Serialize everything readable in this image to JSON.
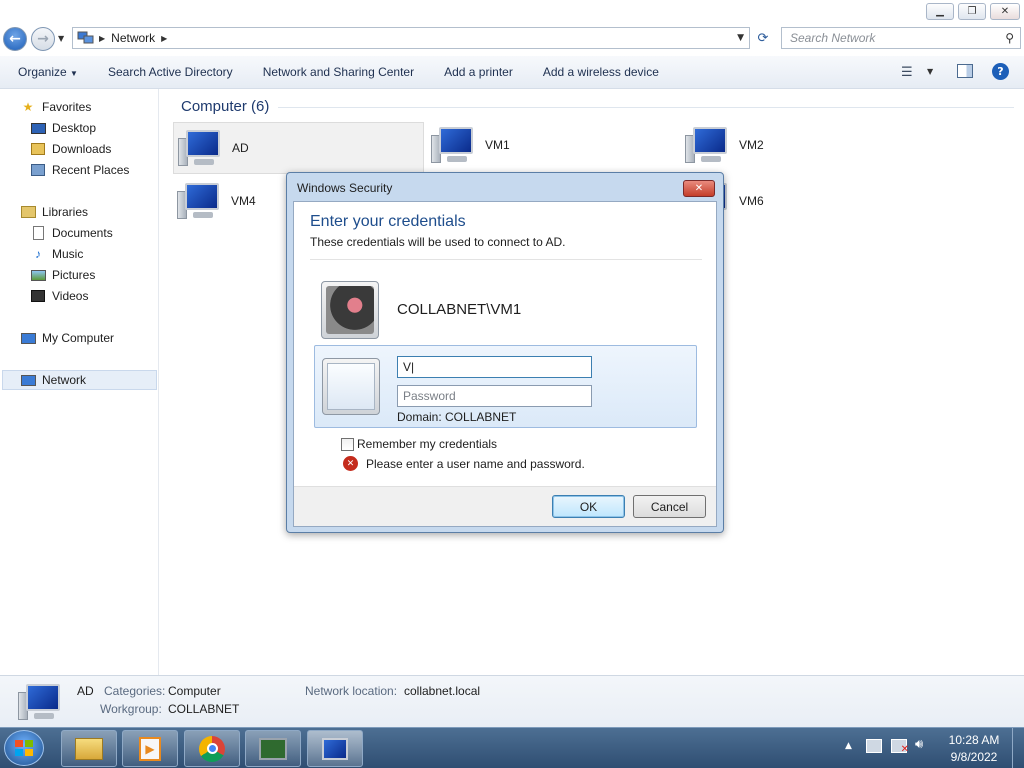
{
  "window": {
    "minimize_glyph": "▁",
    "restore_glyph": "❐",
    "close_glyph": "✕"
  },
  "address": {
    "path": "Network",
    "search_placeholder": "Search Network"
  },
  "toolbar": {
    "organize": "Organize",
    "search_ad": "Search Active Directory",
    "network_sharing": "Network and Sharing Center",
    "add_printer": "Add a printer",
    "add_wireless": "Add a wireless device"
  },
  "nav": {
    "favorites": "Favorites",
    "desktop": "Desktop",
    "downloads": "Downloads",
    "recent_places": "Recent Places",
    "libraries": "Libraries",
    "documents": "Documents",
    "music": "Music",
    "pictures": "Pictures",
    "videos": "Videos",
    "my_computer": "My Computer",
    "network": "Network"
  },
  "content": {
    "group_header": "Computer (6)",
    "computers": [
      "AD",
      "VM1",
      "VM2",
      "VM4",
      "VM6"
    ]
  },
  "details": {
    "name": "AD",
    "categories_label": "Categories:",
    "categories_value": "Computer",
    "workgroup_label": "Workgroup:",
    "workgroup_value": "COLLABNET",
    "location_label": "Network location:",
    "location_value": "collabnet.local"
  },
  "dialog": {
    "title": "Windows Security",
    "heading": "Enter your credentials",
    "subtext": "These credentials will be used to connect to AD.",
    "saved_account": "COLLABNET\\VM1",
    "username_value": "V|",
    "password_placeholder": "Password",
    "domain": "Domain: COLLABNET",
    "remember": "Remember my credentials",
    "error": "Please enter a user name and password.",
    "ok": "OK",
    "cancel": "Cancel"
  },
  "taskbar": {
    "time": "10:28 AM",
    "date": "9/8/2022"
  },
  "colors": {
    "accent": "#1a5fb4",
    "dialog_heading": "#1e4d8c",
    "error_red": "#c42b1c"
  }
}
